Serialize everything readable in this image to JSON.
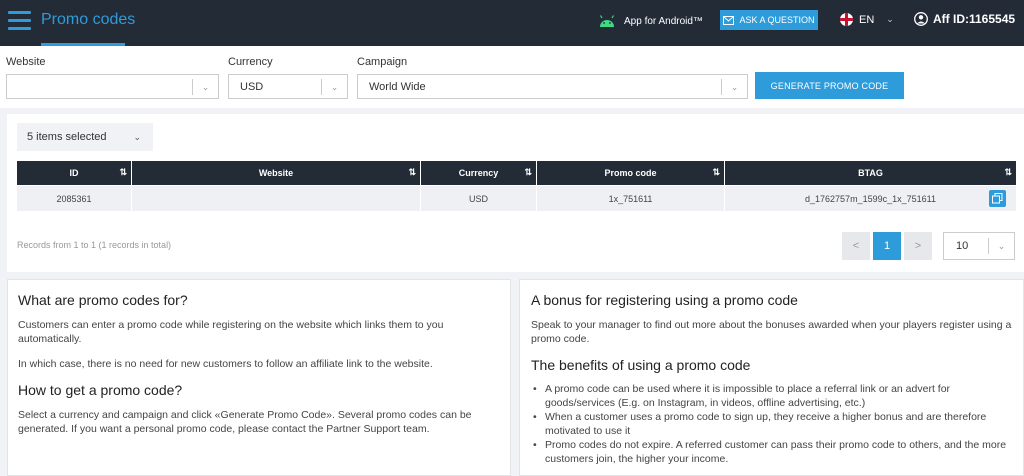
{
  "header": {
    "title": "Promo codes",
    "android_label": "App for Android™",
    "ask_label": "ASK A QUESTION",
    "language": "EN",
    "aff_id": "Aff ID:1165545",
    "icons": [
      "menu-icon",
      "android-icon",
      "mail-icon",
      "uk-flag-icon",
      "chevron-down-icon",
      "user-icon"
    ]
  },
  "filters": {
    "website_label": "Website",
    "website_value": "",
    "currency_label": "Currency",
    "currency_value": "USD",
    "campaign_label": "Campaign",
    "campaign_value": "World Wide",
    "generate_label": "GENERATE PROMO CODE"
  },
  "table": {
    "items_selected": "5 items selected",
    "columns": [
      "ID",
      "Website",
      "Currency",
      "Promo code",
      "BTAG"
    ],
    "rows": [
      {
        "id": "2085361",
        "website": "",
        "currency": "USD",
        "promo_code": "1x_751611",
        "btag": "d_1762757m_1599c_1x_751611"
      }
    ],
    "records_text": "Records from 1 to 1 (1 records in total)",
    "pagination": {
      "prev": "<",
      "current": "1",
      "next": ">",
      "per_page": "10"
    }
  },
  "info_left": {
    "heading1": "What are promo codes for?",
    "para1": "Customers can enter a promo code while registering on the website which links them to you automatically.",
    "para2": "In which case, there is no need for new customers to follow an affiliate link to the website.",
    "heading2": "How to get a promo code?",
    "para3": "Select a currency and campaign and click «Generate Promo Code». Several promo codes can be generated. If you want a personal promo code, please contact the Partner Support team."
  },
  "info_right": {
    "heading1": "A bonus for registering using a promo code",
    "para1": "Speak to your manager to find out more about the bonuses awarded when your players register using a promo code.",
    "heading2": "The benefits of using a promo code",
    "bullets": [
      "A promo code can be used where it is impossible to place a referral link or an advert for goods/services (E.g. on Instagram, in videos, offline advertising, etc.)",
      "When a customer uses a promo code to sign up, they receive a higher bonus and are therefore motivated to use it",
      "Promo codes do not expire. A referred customer can pass their promo code to others, and the more customers join, the higher your income."
    ]
  },
  "colors": {
    "accent": "#2e9bda",
    "header_bg": "#232b37",
    "page_bg": "#f0f2f5"
  }
}
